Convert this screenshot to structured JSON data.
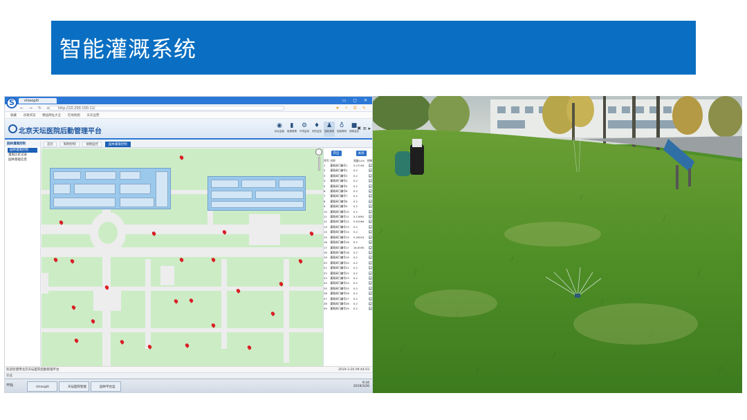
{
  "slide": {
    "title": "智能灌溉系统",
    "banner_color": "#0a6fc2"
  },
  "browser": {
    "logo_glyph": "S",
    "tab_label": "shiaogiti",
    "url": "http://10.200.100.11/",
    "favorites": [
      "收藏",
      "谷歌浏览",
      "精品网址大全",
      "在线地图",
      "天天运营"
    ]
  },
  "app": {
    "title": "北京天坛医院后勤管理平台",
    "modules": [
      {
        "icon": "monitor-icon",
        "glyph": "◉",
        "label": "综合监管"
      },
      {
        "icon": "building-icon",
        "glyph": "▮",
        "label": "能源管理"
      },
      {
        "icon": "gear-icon",
        "glyph": "⚙",
        "label": "环境监测"
      },
      {
        "icon": "fire-icon",
        "glyph": "♦",
        "label": "安防监控"
      },
      {
        "icon": "person-icon",
        "glyph": "♟",
        "label": "智能灌溉"
      },
      {
        "icon": "bulb-icon",
        "glyph": "♁",
        "label": "智能照明"
      },
      {
        "icon": "camera-icon",
        "glyph": "■",
        "label": "视频监控"
      }
    ],
    "right_tools": "✖ ≡ ▸"
  },
  "sidebar": {
    "section": "园林灌溉控制",
    "items": [
      {
        "label": "园林灌溉控制",
        "selected": true
      },
      {
        "label": "灌溉历史记录",
        "selected": false
      },
      {
        "label": "园林基础信息",
        "selected": false
      }
    ]
  },
  "tabs": [
    {
      "label": "首页",
      "active": false
    },
    {
      "label": "照明控制",
      "active": false
    },
    {
      "label": "视频监控",
      "active": false
    },
    {
      "label": "园林灌溉控制",
      "active": true
    }
  ],
  "panel": {
    "buttons": [
      "开启",
      "关闭"
    ],
    "columns": [
      "序号",
      "名称",
      "流量(L/h)",
      "控制"
    ],
    "rows": [
      {
        "no": "1",
        "name": "灌溉阀门编号1",
        "flow": "5.27194"
      },
      {
        "no": "2",
        "name": "灌溉阀门编号2",
        "flow": "0.2"
      },
      {
        "no": "3",
        "name": "灌溉阀门编号3",
        "flow": "0.2"
      },
      {
        "no": "4",
        "name": "灌溉阀门编号4",
        "flow": "0.2"
      },
      {
        "no": "5",
        "name": "灌溉阀门编号5",
        "flow": "0.2"
      },
      {
        "no": "6",
        "name": "灌溉阀门编号6",
        "flow": "0.2"
      },
      {
        "no": "7",
        "name": "灌溉阀门编号7",
        "flow": "0.2"
      },
      {
        "no": "8",
        "name": "灌溉阀门编号8",
        "flow": "0.2"
      },
      {
        "no": "9",
        "name": "灌溉阀门编号9",
        "flow": "0.2"
      },
      {
        "no": "10",
        "name": "灌溉阀门编号10",
        "flow": "0.2"
      },
      {
        "no": "11",
        "name": "灌溉阀门编号11",
        "flow": "5.11891"
      },
      {
        "no": "12",
        "name": "灌溉阀门编号12",
        "flow": "5.91264"
      },
      {
        "no": "13",
        "name": "灌溉阀门编号13",
        "flow": "0.2"
      },
      {
        "no": "14",
        "name": "灌溉阀门编号14",
        "flow": "0.2"
      },
      {
        "no": "15",
        "name": "灌溉阀门编号15",
        "flow": "5.29424"
      },
      {
        "no": "16",
        "name": "灌溉阀门编号16",
        "flow": "0.2"
      },
      {
        "no": "17",
        "name": "灌溉阀门编号17",
        "flow": "16.0595"
      },
      {
        "no": "18",
        "name": "灌溉阀门编号18",
        "flow": "0.2"
      },
      {
        "no": "19",
        "name": "灌溉阀门编号19",
        "flow": "0.2"
      },
      {
        "no": "20",
        "name": "灌溉阀门编号20",
        "flow": "0.2"
      },
      {
        "no": "21",
        "name": "灌溉阀门编号21",
        "flow": "0.2"
      },
      {
        "no": "22",
        "name": "灌溉阀门编号22",
        "flow": "0.2"
      },
      {
        "no": "23",
        "name": "灌溉阀门编号23",
        "flow": "0.2"
      },
      {
        "no": "24",
        "name": "灌溉阀门编号24",
        "flow": "0.2"
      },
      {
        "no": "25",
        "name": "灌溉阀门编号25",
        "flow": "0.2"
      },
      {
        "no": "26",
        "name": "灌溉阀门编号26",
        "flow": "0.2"
      },
      {
        "no": "27",
        "name": "灌溉阀门编号27",
        "flow": "0.2"
      },
      {
        "no": "28",
        "name": "灌溉阀门编号28",
        "flow": "0.2"
      },
      {
        "no": "29",
        "name": "灌溉阀门编号29",
        "flow": "0.2"
      }
    ],
    "control_glyph": "▸"
  },
  "status": {
    "left": "欢迎您使用北京天坛医院后勤管理平台",
    "right": "2019-3-26 09:44:03"
  },
  "browser_bottom": "完成",
  "taskbar": {
    "start": "开始",
    "tasks": [
      "shiaogiti",
      "天坛医院智能系统",
      "园林平台运营.ppt"
    ],
    "time": "9:34",
    "date": "2019/3/26"
  },
  "colors": {
    "map_green": "#ccecc6",
    "pin_red": "#d91f26",
    "building_blue": "#9bc9ec",
    "accent_blue": "#1b5fb7"
  }
}
